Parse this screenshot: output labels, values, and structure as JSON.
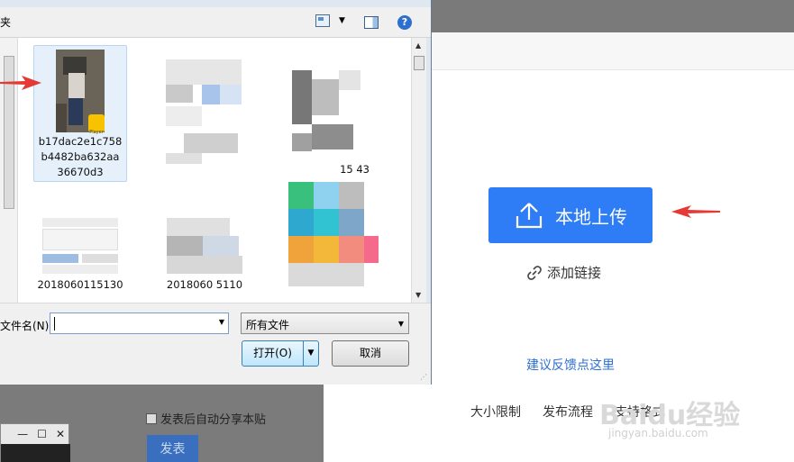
{
  "dialog": {
    "folder_label": "夹",
    "filename_label": "文件名(N):",
    "filename_value": "",
    "filetype_value": "所有文件",
    "open_label": "打开(O)",
    "cancel_label": "取消",
    "files": [
      {
        "name": "b17dac2e1c758b4482ba632aa36670d3",
        "badge": "Player",
        "selected": true
      },
      {
        "name": "",
        "selected": false
      },
      {
        "name": "15 43",
        "selected": false
      },
      {
        "name": "2018060115130",
        "selected": false
      },
      {
        "name": "2018060 5110",
        "selected": false
      },
      {
        "name": "",
        "selected": false
      }
    ]
  },
  "page": {
    "upload_label": "本地上传",
    "add_link_label": "添加链接",
    "feedback_label": "建议反馈点这里",
    "footer_links": [
      "大小限制",
      "发布流程",
      "支持格式"
    ],
    "auto_share_label": "发表后自动分享本贴",
    "publish_label": "发表",
    "watermark": "Baidu经验",
    "watermark_sub": "jingyan.baidu.com",
    "accent_color": "#2e7cf6"
  }
}
